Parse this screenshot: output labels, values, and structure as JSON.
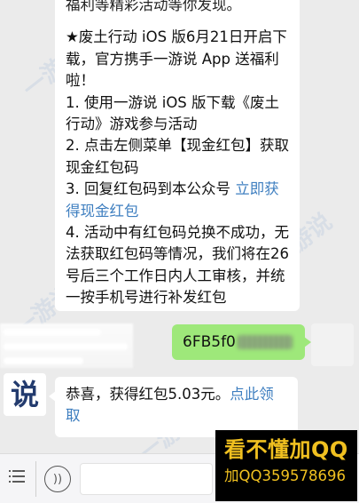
{
  "message1": {
    "top_partial": "福利等精彩活动等你发现。",
    "announcement": "★废土行动 iOS 版6月21日开启下载，官方携手一游说 App 送福利啦！",
    "steps": [
      "1. 使用一游说 iOS 版下载《废土行动》游戏参与活动",
      "2. 点击左侧菜单【现金红包】获取现金红包码"
    ],
    "step3_text": "3. 回复红包码到本公众号 ",
    "step3_link": "立即获得现金红包",
    "step4": "4. 活动中有红包码兑换不成功，无法获取红包码等情况，我们将在26号后三个工作日内人工审核，并统一按手机号进行补发红包"
  },
  "message2": {
    "code_prefix": "6FB5f0"
  },
  "message3": {
    "avatar_char": "说",
    "text": "恭喜，获得红包5.03元。",
    "link": "点此领取"
  },
  "ad": {
    "line1": "看不懂加QQ",
    "line2": "加QQ359578696"
  },
  "watermark_text": "一游说",
  "icons": {
    "menu": "menu-icon",
    "voice": "voice-icon"
  },
  "colors": {
    "background": "#ebebeb",
    "sent_bubble": "#9ee87a",
    "link": "#3f7fc0",
    "ad_text": "#f0c020"
  }
}
